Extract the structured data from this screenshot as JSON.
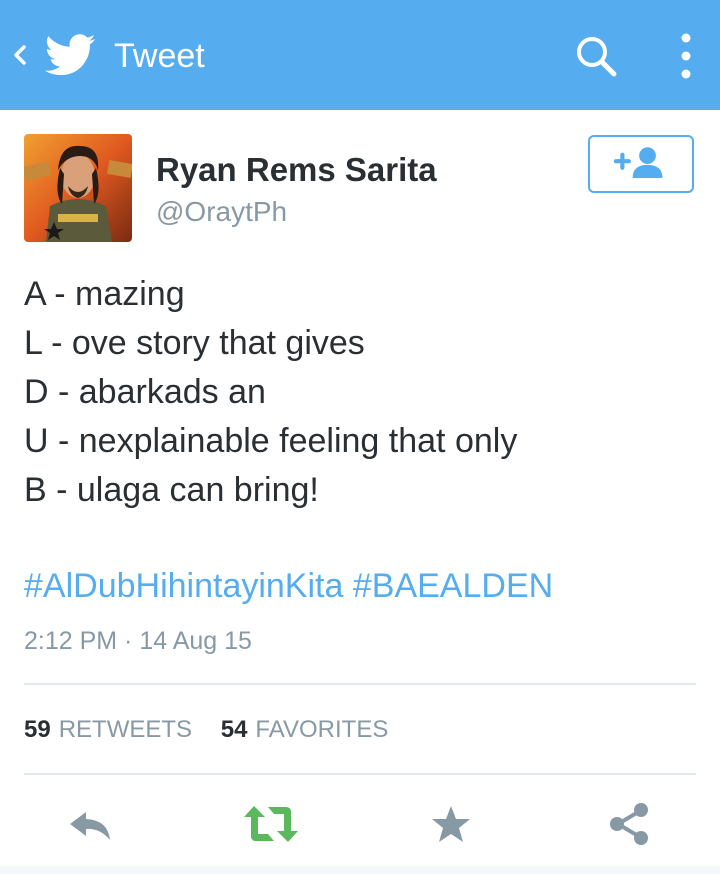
{
  "appbar": {
    "title": "Tweet",
    "color": "#55acee"
  },
  "tweet": {
    "author_name": "Ryan Rems Sarita",
    "author_handle": "@OraytPh",
    "lines": [
      "A - mazing",
      "L - ove story that gives",
      "D - abarkads an",
      "U - nexplainable feeling that only",
      "B - ulaga can bring!"
    ],
    "hashtags": [
      "#AlDubHihintayinKita",
      "#BAEALDEN"
    ],
    "timestamp": "2:12 PM · 14 Aug 15",
    "link_color": "#55acee",
    "retweet_color": "#5cb85c"
  },
  "stats": {
    "retweets_count": "59",
    "retweets_label": "RETWEETS",
    "favorites_count": "54",
    "favorites_label": "FAVORITES"
  },
  "icons": {
    "back": "chevron-left-icon",
    "logo": "twitter-bird-icon",
    "search": "search-icon",
    "overflow": "overflow-menu-icon",
    "follow": "add-person-icon",
    "reply": "reply-icon",
    "retweet": "retweet-icon",
    "favorite": "star-icon",
    "share": "share-icon"
  }
}
